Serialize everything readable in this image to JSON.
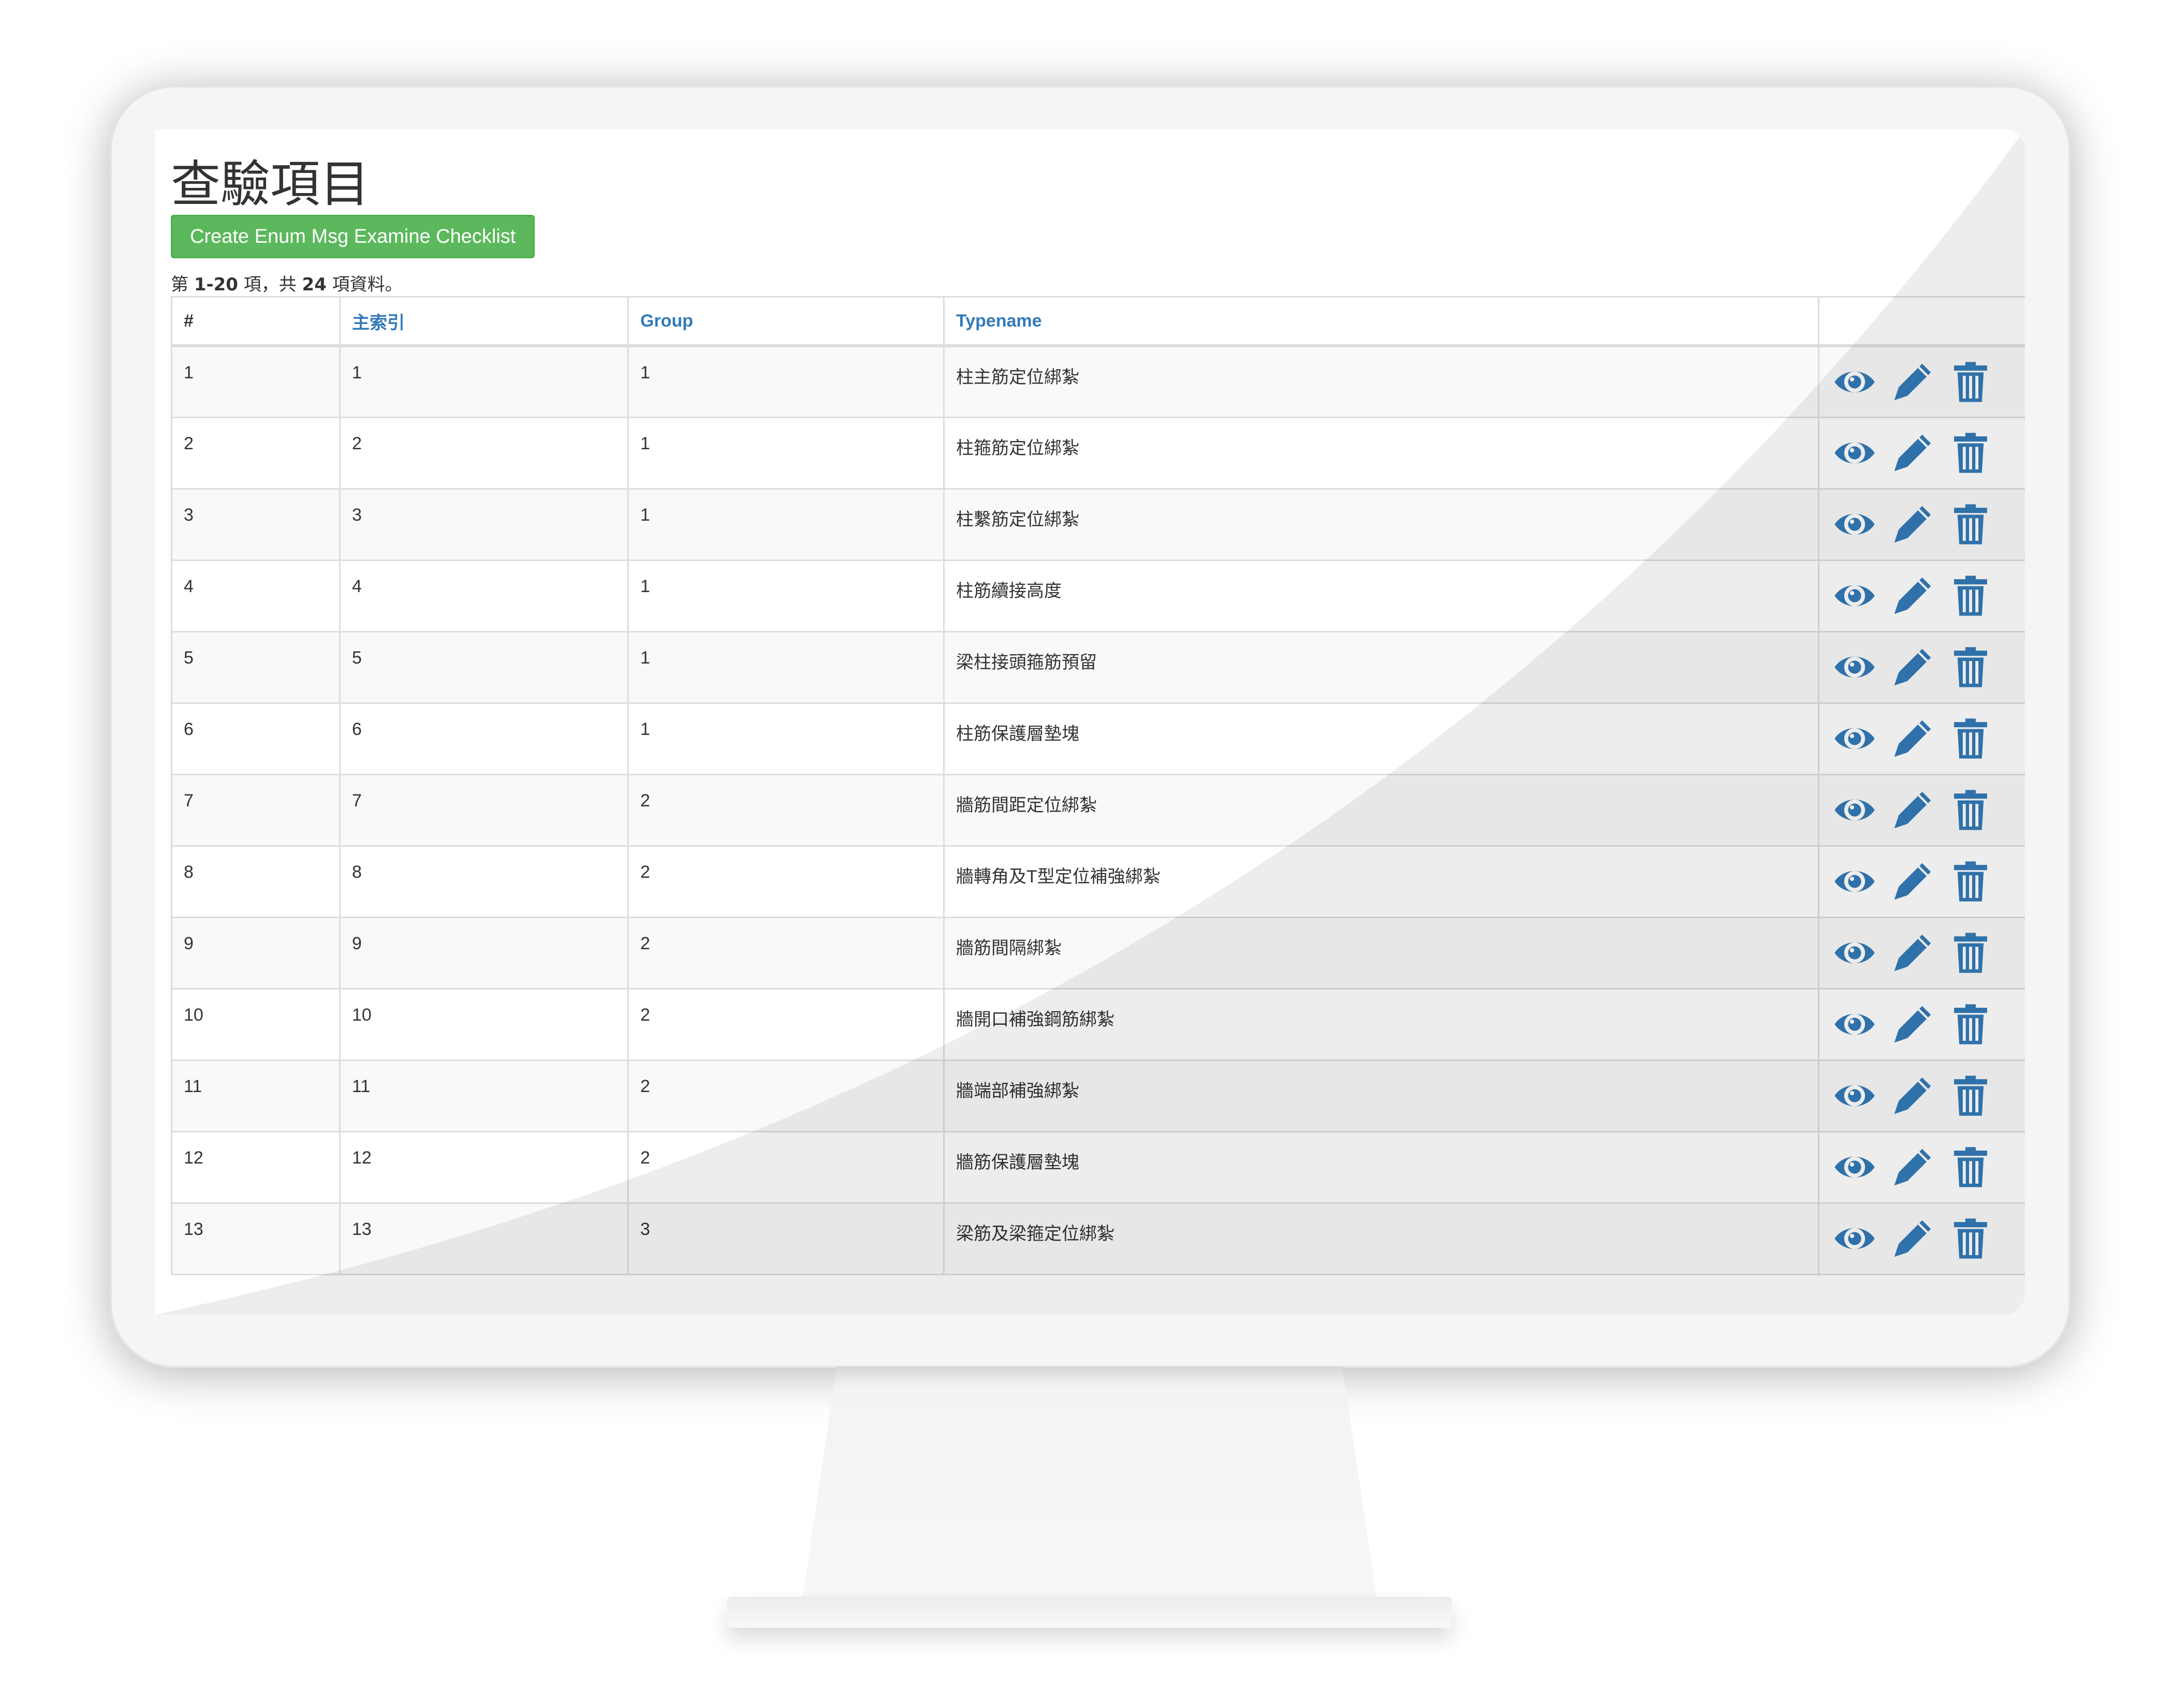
{
  "page": {
    "title": "查驗項目",
    "create_button": "Create Enum Msg Examine Checklist",
    "summary": {
      "prefix": "第 ",
      "range": "1-20",
      "mid": " 項，共 ",
      "total": "24",
      "suffix": " 項資料。"
    }
  },
  "table": {
    "headers": {
      "hash": "#",
      "main_index": "主索引",
      "group": "Group",
      "typename": "Typename"
    },
    "rows": [
      {
        "num": "1",
        "index": "1",
        "group": "1",
        "typename": "柱主筋定位綁紮"
      },
      {
        "num": "2",
        "index": "2",
        "group": "1",
        "typename": "柱箍筋定位綁紮"
      },
      {
        "num": "3",
        "index": "3",
        "group": "1",
        "typename": "柱繫筋定位綁紮"
      },
      {
        "num": "4",
        "index": "4",
        "group": "1",
        "typename": "柱筋續接高度"
      },
      {
        "num": "5",
        "index": "5",
        "group": "1",
        "typename": "梁柱接頭箍筋預留"
      },
      {
        "num": "6",
        "index": "6",
        "group": "1",
        "typename": "柱筋保護層墊塊"
      },
      {
        "num": "7",
        "index": "7",
        "group": "2",
        "typename": "牆筋間距定位綁紮"
      },
      {
        "num": "8",
        "index": "8",
        "group": "2",
        "typename": "牆轉角及T型定位補強綁紮"
      },
      {
        "num": "9",
        "index": "9",
        "group": "2",
        "typename": "牆筋間隔綁紮"
      },
      {
        "num": "10",
        "index": "10",
        "group": "2",
        "typename": "牆開口補強鋼筋綁紮"
      },
      {
        "num": "11",
        "index": "11",
        "group": "2",
        "typename": "牆端部補強綁紮"
      },
      {
        "num": "12",
        "index": "12",
        "group": "2",
        "typename": "牆筋保護層墊塊"
      },
      {
        "num": "13",
        "index": "13",
        "group": "3",
        "typename": "梁筋及梁箍定位綁紮"
      }
    ]
  },
  "icons": {
    "view": "eye-icon",
    "edit": "pencil-icon",
    "delete": "trash-icon"
  },
  "colors": {
    "accent": "#337ab7",
    "button": "#5cb85c",
    "text": "#333333"
  }
}
